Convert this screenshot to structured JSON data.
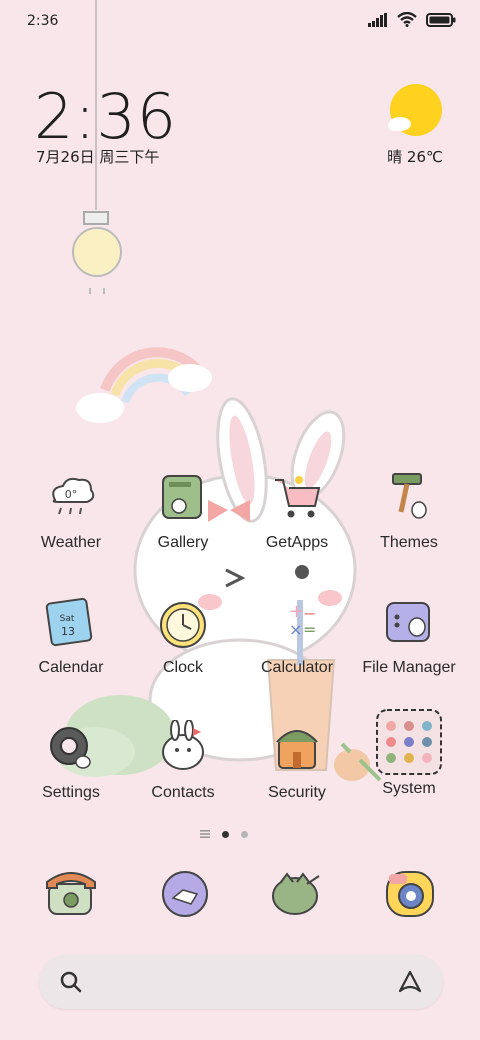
{
  "status": {
    "time": "2:36"
  },
  "widget": {
    "time": "2:36",
    "date": "7月26日 周三下午",
    "weather": "晴 26℃",
    "weather_icon": "sunny-cloud-icon",
    "weather_app_icon_text": "0°",
    "calendar_icon_day": "Sat",
    "calendar_icon_date": "13"
  },
  "apps": [
    {
      "label": "Weather",
      "icon": "weather-icon"
    },
    {
      "label": "Gallery",
      "icon": "gallery-icon"
    },
    {
      "label": "GetApps",
      "icon": "getapps-icon"
    },
    {
      "label": "Themes",
      "icon": "themes-icon"
    },
    {
      "label": "Calendar",
      "icon": "calendar-icon"
    },
    {
      "label": "Clock",
      "icon": "clock-icon"
    },
    {
      "label": "Calculator",
      "icon": "calculator-icon"
    },
    {
      "label": "File Manager",
      "icon": "file-manager-icon"
    },
    {
      "label": "Settings",
      "icon": "settings-icon"
    },
    {
      "label": "Contacts",
      "icon": "contacts-icon"
    },
    {
      "label": "Security",
      "icon": "security-icon"
    },
    {
      "label": "System",
      "icon": "system-folder-icon"
    }
  ],
  "dock": [
    {
      "icon": "phone-icon"
    },
    {
      "icon": "messages-icon"
    },
    {
      "icon": "browser-icon"
    },
    {
      "icon": "camera-icon"
    }
  ],
  "page_indicator": {
    "pages": 2,
    "active": 0
  },
  "colors": {
    "background": "#f9e6ea",
    "sun": "#ffd21f",
    "search_bar": "#ece6e8"
  }
}
